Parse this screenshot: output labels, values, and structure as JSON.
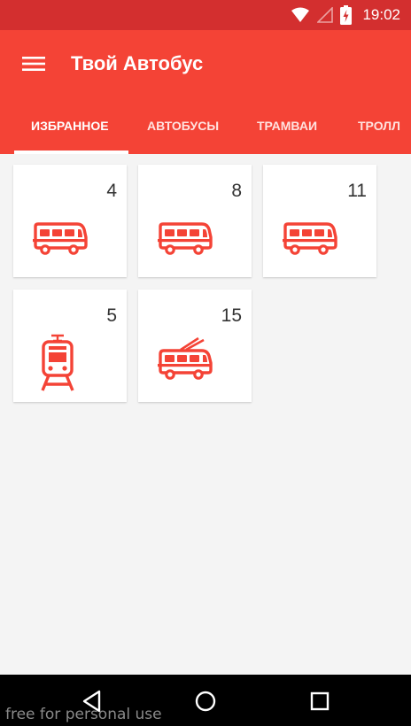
{
  "status_bar": {
    "time": "19:02"
  },
  "app_bar": {
    "title": "Твой Автобус"
  },
  "tabs": [
    {
      "label": "ИЗБРАННОЕ",
      "active": true
    },
    {
      "label": "АВТОБУСЫ",
      "active": false
    },
    {
      "label": "ТРАМВАИ",
      "active": false
    },
    {
      "label": "ТРОЛЛ",
      "active": false
    }
  ],
  "favorites": [
    {
      "number": "4",
      "type": "bus",
      "icon": "bus-icon"
    },
    {
      "number": "8",
      "type": "bus",
      "icon": "bus-icon"
    },
    {
      "number": "11",
      "type": "bus",
      "icon": "bus-icon"
    },
    {
      "number": "5",
      "type": "tram",
      "icon": "tram-icon"
    },
    {
      "number": "15",
      "type": "trolleybus",
      "icon": "trolleybus-icon"
    }
  ],
  "watermark": "free for personal use",
  "colors": {
    "primary": "#f44336",
    "primary_dark": "#d32f2f",
    "icon": "#f44336",
    "background": "#f4f4f4"
  }
}
